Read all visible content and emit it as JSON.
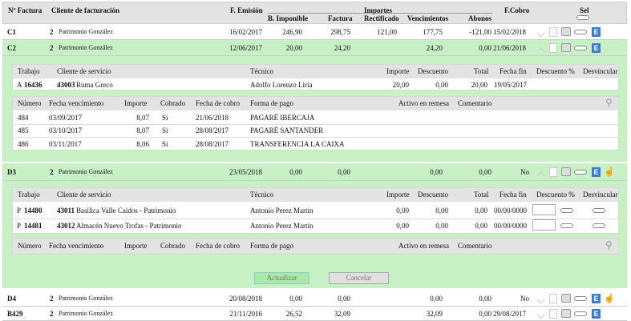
{
  "header": {
    "nfactura": "Nº Factura",
    "cliente": "Cliente de facturación",
    "femision": "F. Emisión",
    "importes": "Importes",
    "bimponible": "B. Imponible",
    "factura": "Factura",
    "rectificado": "Rectificado",
    "vencimientos": "Vencimientos",
    "abonos": "Abonos",
    "fcobro": "F.Cobro",
    "sel": "Sel"
  },
  "rows": [
    {
      "id": "C1",
      "num": "2",
      "client": "Patrimonio González",
      "date": "16/02/2017",
      "base": "246,90",
      "factura": "298,75",
      "rect": "121,00",
      "venc": "177,75",
      "abonos": "-121,00",
      "fcobro": "15/02/2018"
    },
    {
      "id": "C2",
      "num": "2",
      "client": "Patrimonio González",
      "date": "12/06/2017",
      "base": "20,00",
      "factura": "24,20",
      "rect": "",
      "venc": "24,20",
      "abonos": "0,00",
      "fcobro": "21/06/2018"
    },
    {
      "id": "D3",
      "num": "2",
      "client": "Patrimonio González",
      "date": "23/05/2018",
      "base": "0,00",
      "factura": "0,00",
      "rect": "",
      "venc": "0,00",
      "abonos": "0,00",
      "fcobro": "No"
    },
    {
      "id": "D4",
      "num": "2",
      "client": "Patrimonio González",
      "date": "20/08/2018",
      "base": "0,00",
      "factura": "0,00",
      "rect": "",
      "venc": "0,00",
      "abonos": "0,00",
      "fcobro": "No"
    },
    {
      "id": "B429",
      "num": "2",
      "client": "Patrimonio González",
      "date": "21/11/2016",
      "base": "26,52",
      "factura": "32,09",
      "rect": "",
      "venc": "32,09",
      "abonos": "0,00",
      "fcobro": "29/08/2017"
    }
  ],
  "work_header": {
    "trabajo": "Trabajo",
    "cliente": "Cliente de servicio",
    "tecnico": "Técnico",
    "importe": "Importe",
    "descuento": "Descuento",
    "total": "Total",
    "fechafin": "Fecha fin",
    "descpct": "Descuento %",
    "desvincular": "Desvincular"
  },
  "pay_header": {
    "numero": "Número",
    "fechavenc": "Fecha vencimiento",
    "importe": "Importe",
    "cobrado": "Cobrado",
    "fechacobro": "Fecha de cobro",
    "formapago": "Forma de pago",
    "activo": "Activo en remesa",
    "comentario": "Comentario"
  },
  "c2_work": [
    {
      "trabajo_pre": "A",
      "trabajo": "16436",
      "cli_num": "43003",
      "cli_name": "Ruma Greco",
      "tecnico": "Adolfo Lorenzo Liria",
      "importe": "20,00",
      "descuento": "0,00",
      "total": "20,00",
      "fechafin": "19/05/2017"
    }
  ],
  "c2_pay": [
    {
      "numero": "484",
      "fecha": "03/09/2017",
      "importe": "8,07",
      "cobrado": "Si",
      "fcobro": "21/06/2018",
      "forma": "PAGARÉ IBERCAJA"
    },
    {
      "numero": "485",
      "fecha": "03/10/2017",
      "importe": "8,07",
      "cobrado": "Si",
      "fcobro": "28/08/2017",
      "forma": "PAGARÉ SANTANDER"
    },
    {
      "numero": "486",
      "fecha": "03/11/2017",
      "importe": "8,06",
      "cobrado": "Si",
      "fcobro": "28/08/2017",
      "forma": "TRANSFERENCIA LA CAIXA"
    }
  ],
  "d3_work": [
    {
      "trabajo_pre": "P",
      "trabajo": "14480",
      "cli_num": "43011",
      "cli_name": "Basilica Valle Caidos - Patrimonio",
      "tecnico": "Antonio Perez Martin",
      "importe": "0,00",
      "descuento": "0,00",
      "total": "0,00",
      "fechafin": "00/00/0000"
    },
    {
      "trabajo_pre": "P",
      "trabajo": "14481",
      "cli_num": "43012",
      "cli_name": "Almacén Nuevo Trofas - Patrimonio",
      "tecnico": "Antonio Perez Martin",
      "importe": "0,00",
      "descuento": "0,00",
      "total": "0,00",
      "fechafin": "00/00/0000"
    }
  ],
  "buttons": {
    "actualizar": "Actualizar",
    "cancelar": "Cancelar"
  },
  "icons": {
    "expand": "chevron-up-icon",
    "doc": "document-icon",
    "print": "printer-icon",
    "toggle": "toggle-icon",
    "e": "E",
    "hand": "hand-pointer-icon",
    "search": "search-icon"
  },
  "colors": {
    "expanded_bg": "#c7f0c4",
    "header_bg": "#e3e3e3",
    "e_badge": "#3a7bd5"
  }
}
